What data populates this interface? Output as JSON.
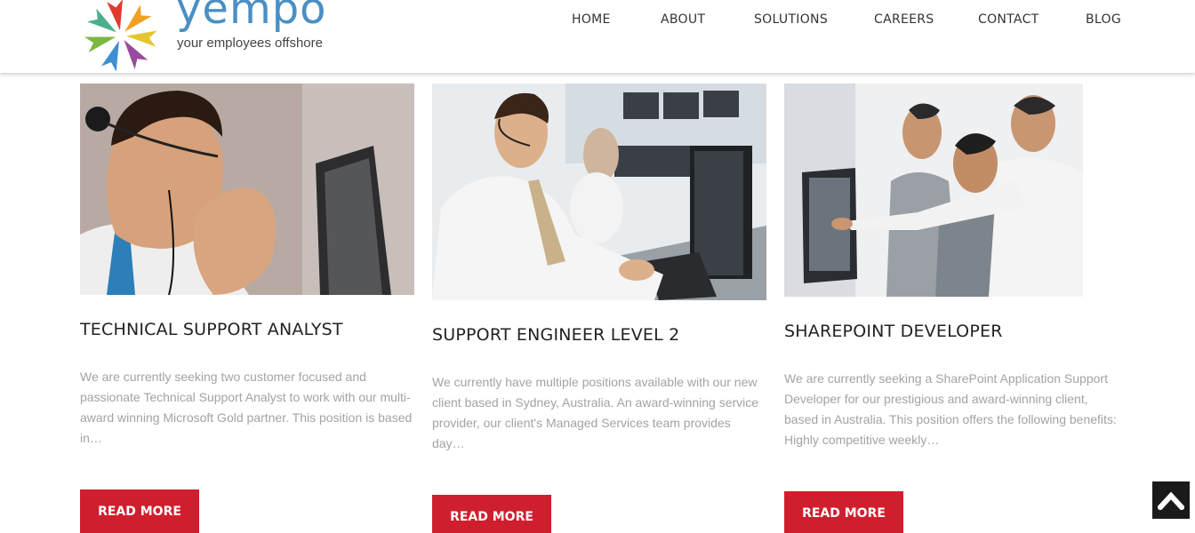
{
  "header": {
    "logo_word": "yempo",
    "logo_tagline": "your employees offshore",
    "nav": [
      {
        "label": "HOME"
      },
      {
        "label": "ABOUT"
      },
      {
        "label": "SOLUTIONS"
      },
      {
        "label": "CAREERS"
      },
      {
        "label": "CONTACT"
      },
      {
        "label": "BLOG"
      }
    ]
  },
  "jobs": [
    {
      "title": "TECHNICAL SUPPORT ANALYST",
      "summary": "We are currently seeking two customer focused and passionate Technical Support Analyst to work with our multi-award winning Microsoft Gold partner. This position is based in…",
      "button": "READ MORE"
    },
    {
      "title": "SUPPORT ENGINEER LEVEL 2",
      "summary": "We currently have multiple positions available with our new client based in Sydney, Australia. An award-winning service provider, our client's Managed Services team provides day…",
      "button": "READ MORE"
    },
    {
      "title": "SHAREPOINT DEVELOPER",
      "summary": "We are currently seeking a SharePoint Application Support Developer for our prestigious and award-winning client, based in Australia. This position offers the following benefits: Highly competitive weekly…",
      "button": "READ MORE"
    }
  ],
  "colors": {
    "accent_red": "#cf1f2e",
    "logo_blue": "#4a8fc4",
    "body_text": "#a3a3a3"
  },
  "icons": {
    "scroll_top": "chevron-up-icon"
  }
}
